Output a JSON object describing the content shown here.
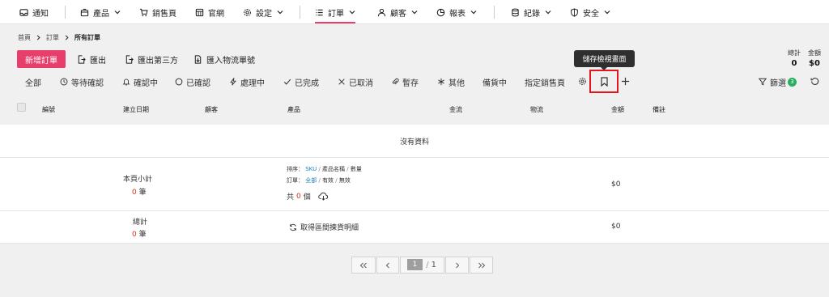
{
  "nav": {
    "notify": "通知",
    "products": "產品",
    "sales_page": "銷售頁",
    "website": "官網",
    "settings": "設定",
    "orders": "訂單",
    "customers": "顧客",
    "reports": "報表",
    "logs": "紀錄",
    "security": "安全"
  },
  "breadcrumb": {
    "home": "首頁",
    "orders": "訂單",
    "current": "所有訂單"
  },
  "actions": {
    "new_order": "新增訂單",
    "export": "匯出",
    "export_third": "匯出第三方",
    "import_tracking": "匯入物流單號"
  },
  "stats": {
    "count_label": "總計",
    "count_value": "0",
    "amount_label": "金額",
    "amount_value": "$0"
  },
  "filters": {
    "all": "全部",
    "pending": "等待確認",
    "confirming": "確認中",
    "confirmed": "已確認",
    "processing": "處理中",
    "completed": "已完成",
    "cancelled": "已取消",
    "draft": "暫存",
    "other": "其他",
    "stocking": "備貨中",
    "assigned_page": "指定銷售頁"
  },
  "tooltip": "儲存檢視畫面",
  "filter_button": {
    "label": "篩選",
    "count": "3"
  },
  "table": {
    "headers": {
      "number": "編號",
      "created": "建立日期",
      "customer": "顧客",
      "product": "產品",
      "cash_flow": "金流",
      "logistics": "物流",
      "amount": "金額",
      "notes": "備註"
    },
    "no_data": "沒有資料"
  },
  "subtotal": {
    "label": "本頁小計",
    "count": "0",
    "unit": "筆",
    "sort_label": "排序：",
    "sort_opt1": "SKU",
    "sort_opt2": "產品名稱",
    "sort_opt3": "數量",
    "order_label": "訂單：",
    "order_opt1": "全部",
    "order_opt2": "有效",
    "order_opt3": "無效",
    "total_prefix": "共",
    "total_count": "0",
    "total_unit": "個",
    "amount": "$0"
  },
  "total": {
    "label": "總計",
    "count": "0",
    "unit": "筆",
    "fetch_link": "取得區間揀貨明細",
    "amount": "$0"
  },
  "pagination": {
    "current": "1",
    "sep": "/",
    "total": "1"
  }
}
